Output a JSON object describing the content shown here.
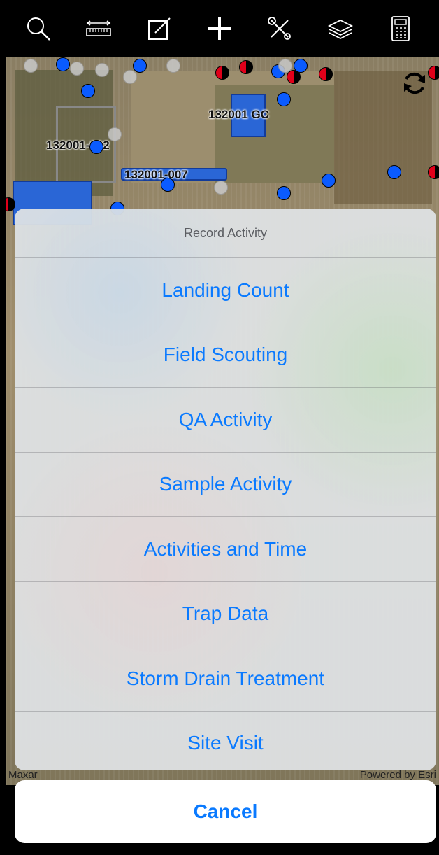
{
  "toolbar": {
    "icons": [
      "search-icon",
      "measure-icon",
      "edit-icon",
      "add-icon",
      "tools-icon",
      "layers-icon",
      "calculator-icon"
    ]
  },
  "map": {
    "parcels": [
      "132001 GC",
      "132001-002",
      "132001-007"
    ],
    "attribution_left": "Maxar",
    "attribution_right": "Powered by Esri"
  },
  "action_sheet": {
    "title": "Record Activity",
    "items": [
      "Landing Count",
      "Field Scouting",
      "QA Activity",
      "Sample Activity",
      "Activities and Time",
      "Trap Data",
      "Storm Drain Treatment",
      "Site Visit"
    ],
    "cancel_label": "Cancel"
  },
  "colors": {
    "accent": "#0a7aff",
    "point_blue": "#0a5bff",
    "point_red": "#e0001a"
  }
}
